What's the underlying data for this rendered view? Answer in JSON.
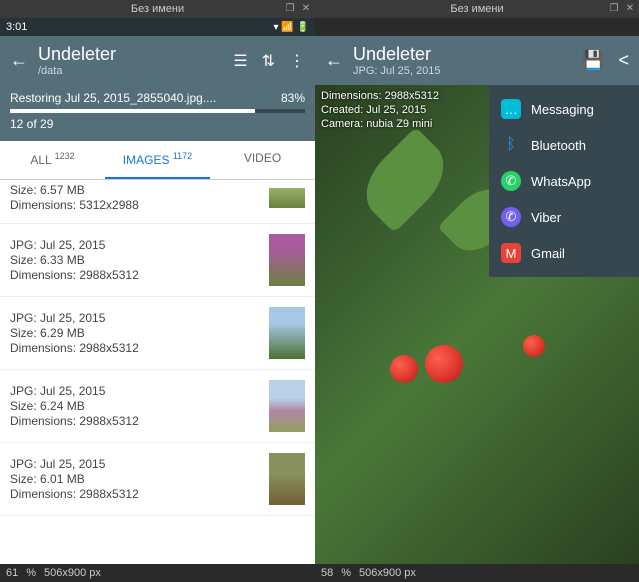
{
  "left": {
    "windowTitle": "Без имени",
    "time": "3:01",
    "appTitle": "Undeleter",
    "subtitle": "/data",
    "restoring": "Restoring Jul 25, 2015_2855040.jpg....",
    "progressPct": "83%",
    "countOf": "12 of 29",
    "tabs": {
      "all": "ALL",
      "allCount": "1232",
      "images": "IMAGES",
      "imagesCount": "1172",
      "video": "VIDEO"
    },
    "items": [
      {
        "line1": "Size: 6.57 MB",
        "line2": "Dimensions: 5312x2988"
      },
      {
        "line1": "JPG: Jul 25, 2015",
        "line2": "Size: 6.33 MB",
        "line3": "Dimensions: 2988x5312"
      },
      {
        "line1": "JPG: Jul 25, 2015",
        "line2": "Size: 6.29 MB",
        "line3": "Dimensions: 2988x5312"
      },
      {
        "line1": "JPG: Jul 25, 2015",
        "line2": "Size: 6.24 MB",
        "line3": "Dimensions: 2988x5312"
      },
      {
        "line1": "JPG: Jul 25, 2015",
        "line2": "Size: 6.01 MB",
        "line3": "Dimensions: 2988x5312"
      }
    ],
    "bottom": {
      "zoom": "61",
      "unit": "%",
      "dim": "506x900 px"
    }
  },
  "right": {
    "windowTitle": "Без имени",
    "appTitle": "Undeleter",
    "subtitle": "JPG: Jul 25, 2015",
    "meta": {
      "dim": "Dimensions: 2988x5312",
      "created": "Created: Jul 25, 2015",
      "camera": "Camera: nubia Z9 mini"
    },
    "share": [
      {
        "label": "Messaging",
        "cls": "si-msg",
        "glyph": "✉"
      },
      {
        "label": "Bluetooth",
        "cls": "si-bt",
        "glyph": "∦"
      },
      {
        "label": "WhatsApp",
        "cls": "si-wa",
        "glyph": "✆"
      },
      {
        "label": "Viber",
        "cls": "si-vb",
        "glyph": "✆"
      },
      {
        "label": "Gmail",
        "cls": "si-gm",
        "glyph": "M"
      }
    ],
    "bottom": {
      "zoom": "58",
      "unit": "%",
      "dim": "506x900 px"
    }
  }
}
